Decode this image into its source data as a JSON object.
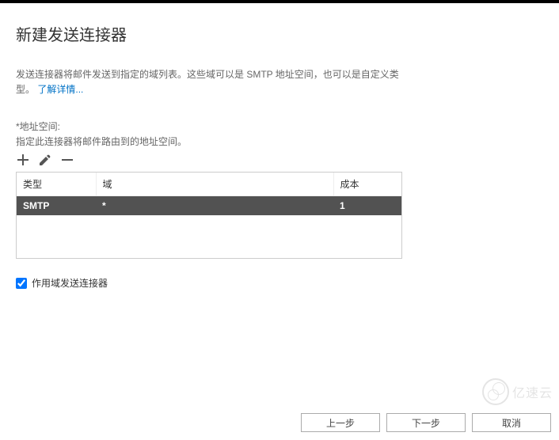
{
  "header": {
    "title": "新建发送连接器"
  },
  "description": {
    "text": "发送连接器将邮件发送到指定的域列表。这些域可以是 SMTP 地址空间，也可以是自定义类型。",
    "link_text": "了解详情..."
  },
  "address_space": {
    "label": "*地址空间:",
    "sub": "指定此连接器将邮件路由到的地址空间。"
  },
  "table": {
    "headers": {
      "type": "类型",
      "domain": "域",
      "cost": "成本"
    },
    "rows": [
      {
        "type": "SMTP",
        "domain": "*",
        "cost": "1"
      }
    ]
  },
  "checkbox": {
    "label": "作用域发送连接器",
    "checked": true
  },
  "buttons": {
    "back": "上一步",
    "next": "下一步",
    "cancel": "取消"
  },
  "watermark": {
    "text": "亿速云"
  }
}
